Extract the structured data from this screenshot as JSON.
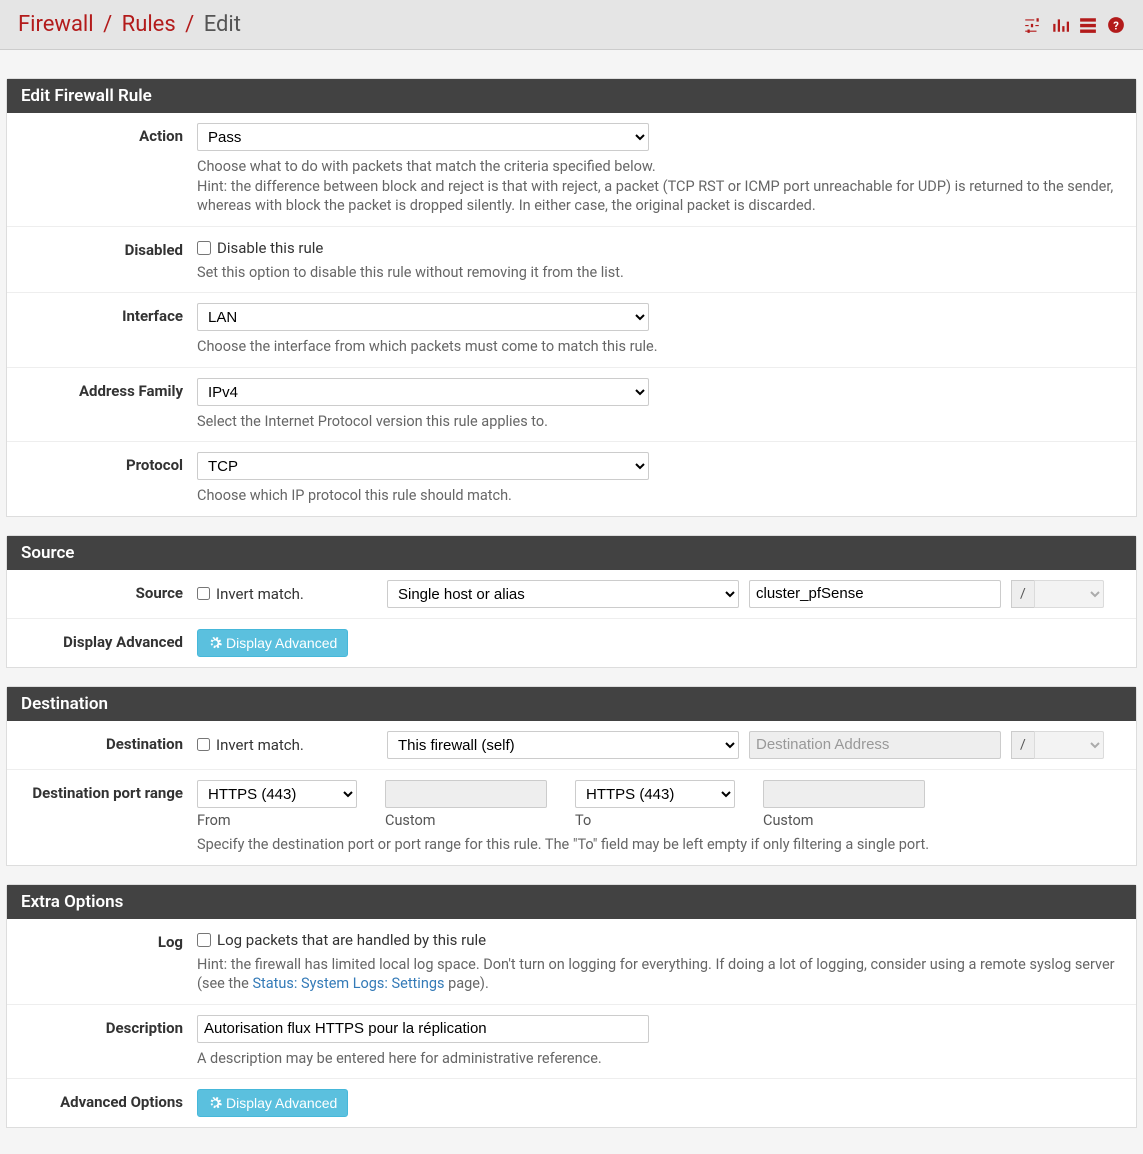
{
  "breadcrumb": {
    "l1": "Firewall",
    "l2": "Rules",
    "l3": "Edit"
  },
  "panels": {
    "edit": {
      "title": "Edit Firewall Rule",
      "action": {
        "label": "Action",
        "value": "Pass",
        "help": "Choose what to do with packets that match the criteria specified below.\nHint: the difference between block and reject is that with reject, a packet (TCP RST or ICMP port unreachable for UDP) is returned to the sender, whereas with block the packet is dropped silently. In either case, the original packet is discarded."
      },
      "disabled": {
        "label": "Disabled",
        "check_label": "Disable this rule",
        "help": "Set this option to disable this rule without removing it from the list."
      },
      "interface": {
        "label": "Interface",
        "value": "LAN",
        "help": "Choose the interface from which packets must come to match this rule."
      },
      "family": {
        "label": "Address Family",
        "value": "IPv4",
        "help": "Select the Internet Protocol version this rule applies to."
      },
      "protocol": {
        "label": "Protocol",
        "value": "TCP",
        "help": "Choose which IP protocol this rule should match."
      }
    },
    "source": {
      "title": "Source",
      "source": {
        "label": "Source",
        "invert_label": "Invert match.",
        "type_value": "Single host or alias",
        "addr_value": "cluster_pfSense",
        "mask_label": "/"
      },
      "display_adv": {
        "label": "Display Advanced",
        "button": "Display Advanced"
      }
    },
    "destination": {
      "title": "Destination",
      "dest": {
        "label": "Destination",
        "invert_label": "Invert match.",
        "type_value": "This firewall (self)",
        "addr_placeholder": "Destination Address",
        "mask_label": "/"
      },
      "port": {
        "label": "Destination port range",
        "from_value": "HTTPS (443)",
        "from_sub": "From",
        "to_value": "HTTPS (443)",
        "to_sub": "To",
        "custom_sub": "Custom",
        "help": "Specify the destination port or port range for this rule. The \"To\" field may be left empty if only filtering a single port."
      }
    },
    "extra": {
      "title": "Extra Options",
      "log": {
        "label": "Log",
        "check_label": "Log packets that are handled by this rule",
        "help_pre": "Hint: the firewall has limited local log space. Don't turn on logging for everything. If doing a lot of logging, consider using a remote syslog server (see the ",
        "help_link": "Status: System Logs: Settings",
        "help_post": " page)."
      },
      "description": {
        "label": "Description",
        "value": "Autorisation flux HTTPS pour la réplication",
        "help": "A description may be entered here for administrative reference."
      },
      "advanced": {
        "label": "Advanced Options",
        "button": "Display Advanced"
      }
    }
  }
}
